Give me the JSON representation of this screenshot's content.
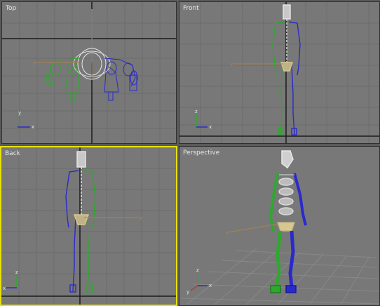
{
  "viewports": {
    "top": {
      "label": "Top",
      "axes": {
        "primary": "y",
        "secondary": "x"
      }
    },
    "front": {
      "label": "Front",
      "axes": {
        "primary": "z",
        "secondary": "x"
      }
    },
    "back": {
      "label": "Back",
      "axes": {
        "primary": "z",
        "secondary": "x"
      }
    },
    "perspective": {
      "label": "Perspective",
      "axes": {
        "primary": "z",
        "secondary": "x",
        "tertiary": "y"
      }
    }
  },
  "colors": {
    "viewport_bg": "#787878",
    "grid": "#6c6c6c",
    "grid_main": "#1a1a1a",
    "active_border": "#e6e200",
    "bone_left": "#2ea82e",
    "bone_right": "#2a2acc",
    "spine": "#e8e8e8",
    "pelvis": "#d8c890",
    "gizmo_axis": "#b08050"
  },
  "active_viewport": "back"
}
